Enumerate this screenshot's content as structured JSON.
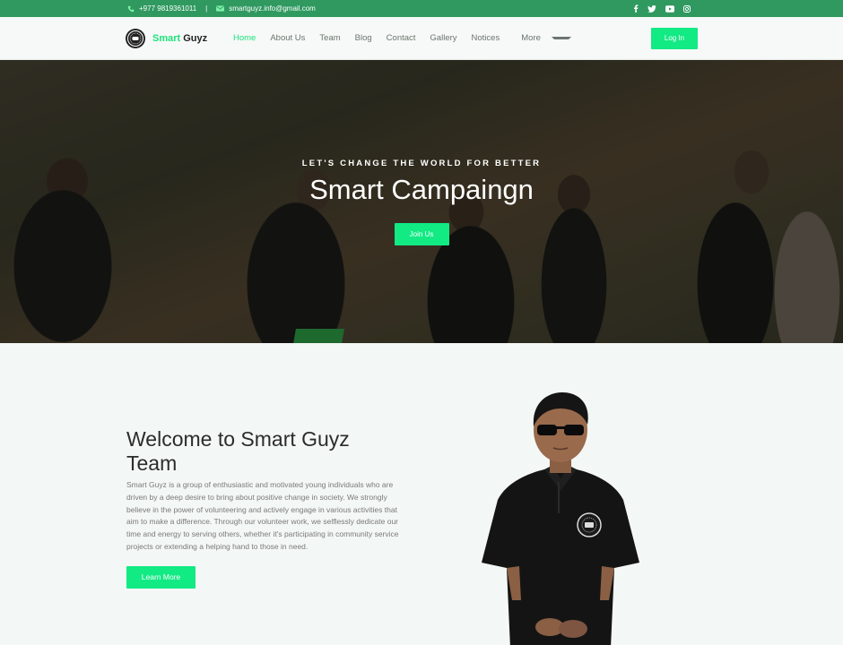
{
  "topbar": {
    "phone": "+977 9819361011",
    "separator": "|",
    "email": "smartguyz.info@gmail.com",
    "social_icons": [
      "facebook-icon",
      "twitter-icon",
      "youtube-icon",
      "instagram-icon"
    ]
  },
  "nav": {
    "brand_first": "Smart",
    "brand_second": "Guyz",
    "items": [
      "Home",
      "About Us",
      "Team",
      "Blog",
      "Contact",
      "Gallery",
      "Notices",
      "More"
    ],
    "active": "Home",
    "login": "Log In"
  },
  "hero": {
    "tagline": "LET'S CHANGE THE WORLD FOR BETTER",
    "title": "Smart Campaingn",
    "button": "Join Us"
  },
  "welcome": {
    "heading": "Welcome to Smart Guyz Team",
    "body": "Smart Guyz is a group of enthusiastic and motivated young individuals who are driven by a deep desire to bring about positive change in society. We strongly believe in the power of volunteering and actively engage in various activities that aim to make a difference. Through our volunteer work, we selflessly dedicate our time and energy to serving others, whether it's participating in community service projects or extending a helping hand to those in need.",
    "button": "Learn More"
  },
  "colors": {
    "topbar": "#2f9960",
    "accent": "#12ea84",
    "brand_green": "#1de27c"
  }
}
